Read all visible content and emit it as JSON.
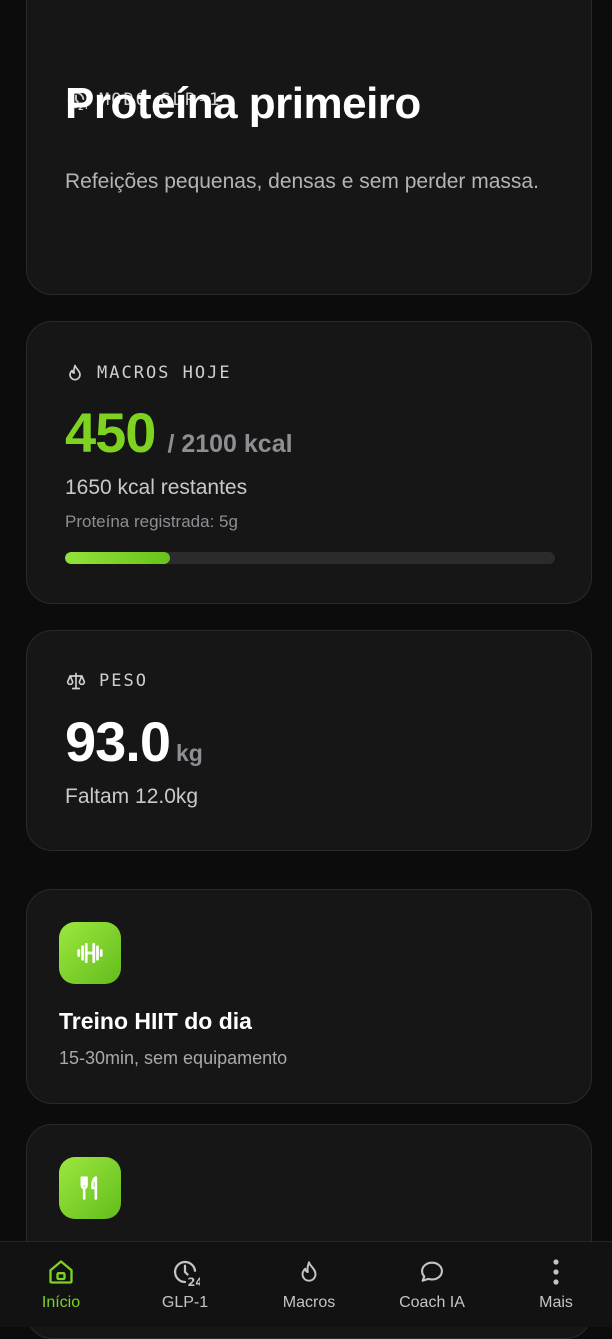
{
  "glp_card": {
    "eyebrow": "MODO GLP-1",
    "title": "Proteína primeiro",
    "subtitle": "Refeições pequenas, densas e sem perder massa."
  },
  "macros_card": {
    "eyebrow": "MACROS HOJE",
    "consumed": "450",
    "total": "/ 2100 kcal",
    "remaining": "1650 kcal restantes",
    "protein": "Proteína registrada: 5g",
    "progress_fraction": 0.214
  },
  "weight_card": {
    "eyebrow": "PESO",
    "value": "93.0",
    "unit": "kg",
    "remaining": "Faltam 12.0kg"
  },
  "features": [
    {
      "icon": "dumbbell-icon",
      "title": "Treino HIIT do dia",
      "subtitle": "15-30min, sem equipamento"
    },
    {
      "icon": "utensils-icon"
    }
  ],
  "nav": {
    "items": [
      {
        "label": "Início",
        "icon": "home-icon",
        "active": true
      },
      {
        "label": "GLP-1",
        "icon": "clock-24-icon",
        "active": false
      },
      {
        "label": "Macros",
        "icon": "flame-icon",
        "active": false
      },
      {
        "label": "Coach IA",
        "icon": "chat-bubble-icon",
        "active": false
      },
      {
        "label": "Mais",
        "icon": "more-vertical-icon",
        "active": false
      }
    ]
  },
  "colors": {
    "accent": "#7ed321",
    "card": "#161617",
    "background": "#0c0c0d"
  }
}
